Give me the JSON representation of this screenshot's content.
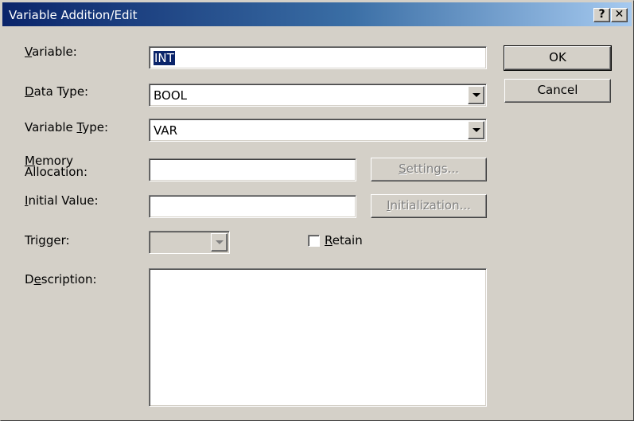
{
  "window": {
    "title": "Variable Addition/Edit",
    "help_button": "?",
    "close_button": "✕"
  },
  "labels": {
    "variable": {
      "accel": "V",
      "rest": "ariable:"
    },
    "data_type": {
      "accel": "D",
      "rest": "ata Type:"
    },
    "variable_type": {
      "pre": "Variable ",
      "accel": "T",
      "rest": "ype:"
    },
    "memory_allocation_line1": {
      "accel": "M",
      "rest": "emory"
    },
    "memory_allocation_line2": "Allocation:",
    "initial_value": {
      "accel": "I",
      "rest": "nitial Value:"
    },
    "trigger": {
      "pre": "Tri",
      "accel": "g",
      "rest": "ger:"
    },
    "description": {
      "pre": "D",
      "accel": "e",
      "rest": "scription:"
    }
  },
  "fields": {
    "variable": {
      "value": "INT",
      "selected": true
    },
    "data_type": {
      "value": "BOOL"
    },
    "variable_type": {
      "value": "VAR"
    },
    "memory_allocation": {
      "value": ""
    },
    "initial_value": {
      "value": ""
    },
    "trigger": {
      "value": "",
      "disabled": true
    },
    "description": {
      "value": ""
    }
  },
  "buttons": {
    "ok": "OK",
    "cancel": "Cancel",
    "settings": {
      "accel": "S",
      "rest": "ettings..."
    },
    "initialization": {
      "accel": "I",
      "rest": "nitialization..."
    }
  },
  "checkbox": {
    "retain": {
      "accel": "R",
      "rest": "etain",
      "checked": false
    }
  },
  "colors": {
    "face": "#d4d0c8",
    "title_start": "#0a246a",
    "title_end": "#a6caf0",
    "disabled_text": "#808080"
  }
}
